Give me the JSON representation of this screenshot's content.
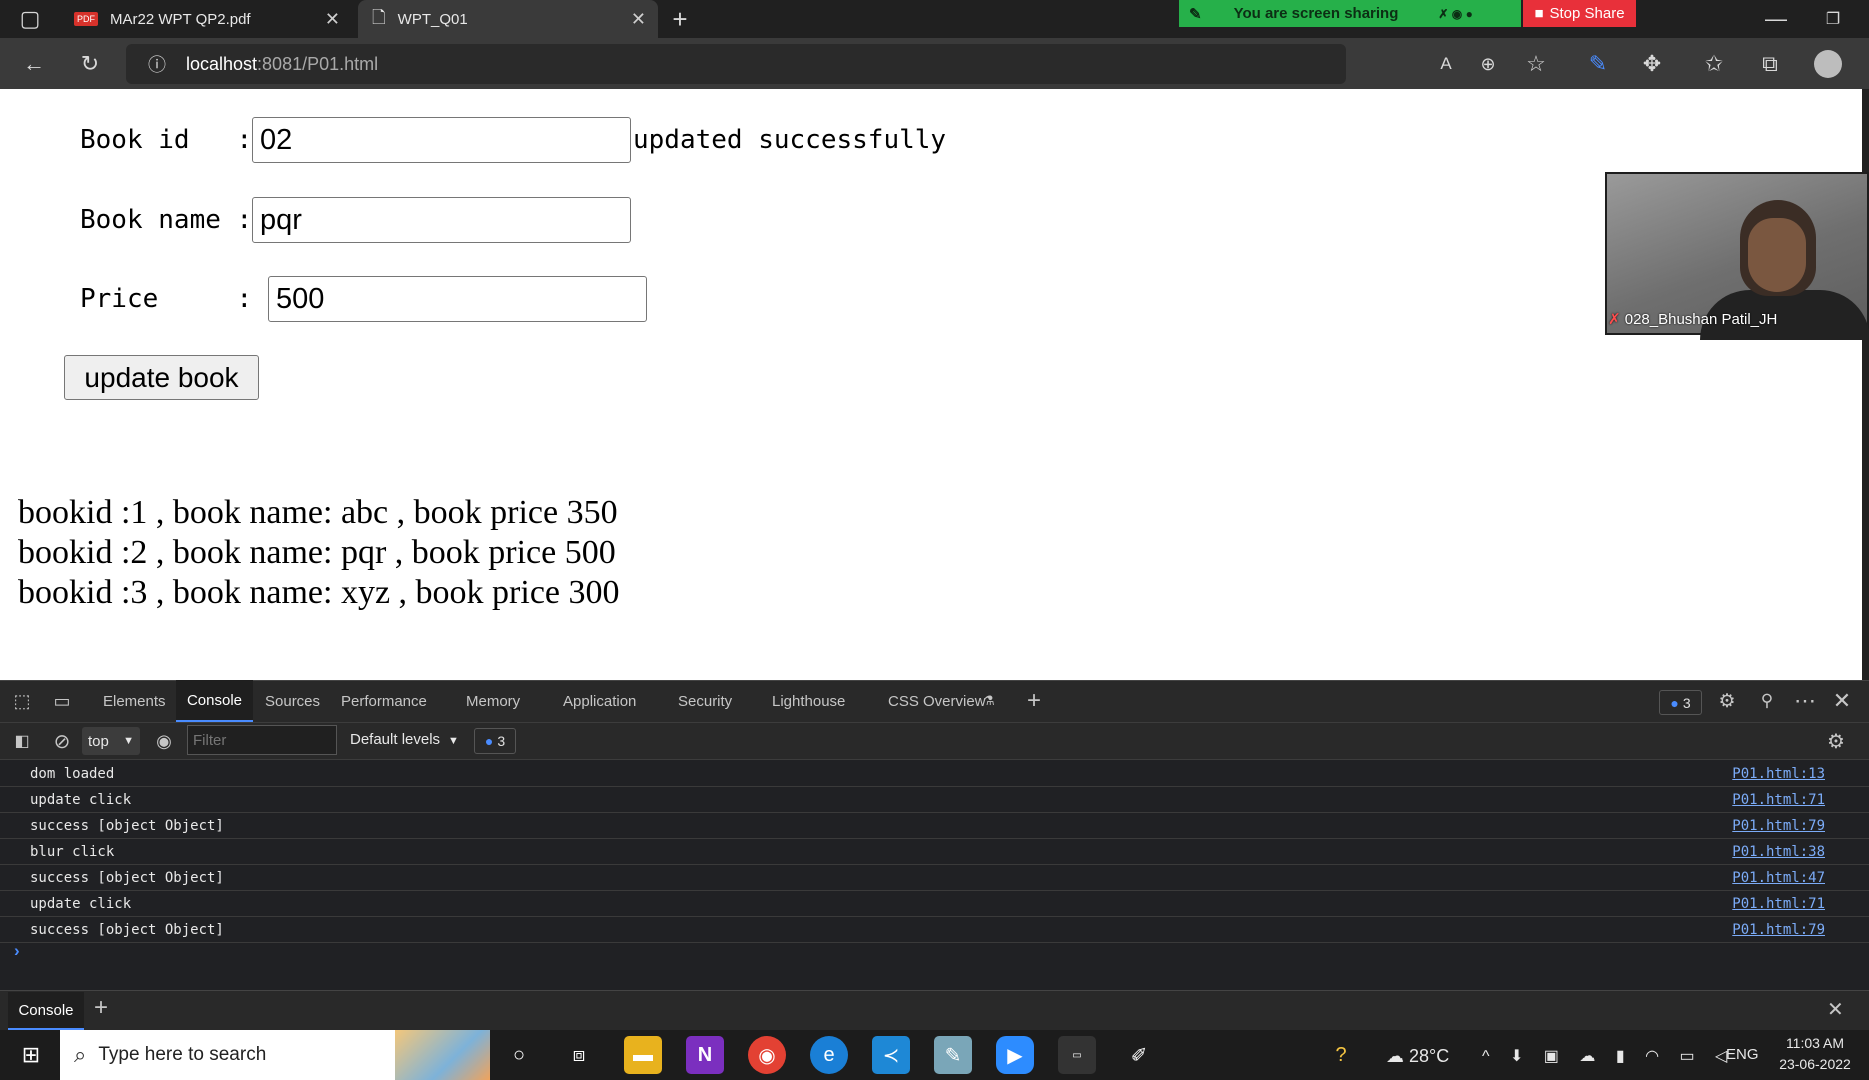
{
  "browser": {
    "tabs": [
      {
        "label": "MAr22 WPT QP2.pdf"
      },
      {
        "label": "WPT_Q01"
      }
    ],
    "url_host": "localhost",
    "url_rest": ":8081/P01.html",
    "share_text": "You are screen sharing",
    "stop_share": "Stop Share"
  },
  "form": {
    "book_id_label": "Book id   :",
    "book_id_value": "02",
    "status": "updated successfully",
    "book_name_label": "Book name :",
    "book_name_value": "pqr",
    "price_label": "Price     :",
    "price_value": "500",
    "update_button": "update book"
  },
  "books": [
    "bookid :1 , book name: abc , book price 350",
    "bookid :2 , book name: pqr , book price 500",
    "bookid :3 , book name: xyz , book price 300"
  ],
  "video": {
    "participant": "028_Bhushan Patil_JH"
  },
  "devtools": {
    "tabs": [
      "Elements",
      "Console",
      "Sources",
      "Performance",
      "Memory",
      "Application",
      "Security",
      "Lighthouse",
      "CSS Overview"
    ],
    "issues_count": "3",
    "context": "top",
    "filter_placeholder": "Filter",
    "levels": "Default levels",
    "messages_count": "3",
    "console_rows": [
      {
        "msg": "dom loaded",
        "src": "P01.html:13"
      },
      {
        "msg": "update click",
        "src": "P01.html:71"
      },
      {
        "msg": "success [object Object]",
        "src": "P01.html:79"
      },
      {
        "msg": "blur click",
        "src": "P01.html:38"
      },
      {
        "msg": "success [object Object]",
        "src": "P01.html:47"
      },
      {
        "msg": "update click",
        "src": "P01.html:71"
      },
      {
        "msg": "success [object Object]",
        "src": "P01.html:79"
      }
    ],
    "prompt": "›",
    "drawer_tab": "Console"
  },
  "taskbar": {
    "search_placeholder": "Type here to search",
    "weather": "28°C",
    "lang": "ENG",
    "time": "11:03 AM",
    "date": "23-06-2022"
  }
}
